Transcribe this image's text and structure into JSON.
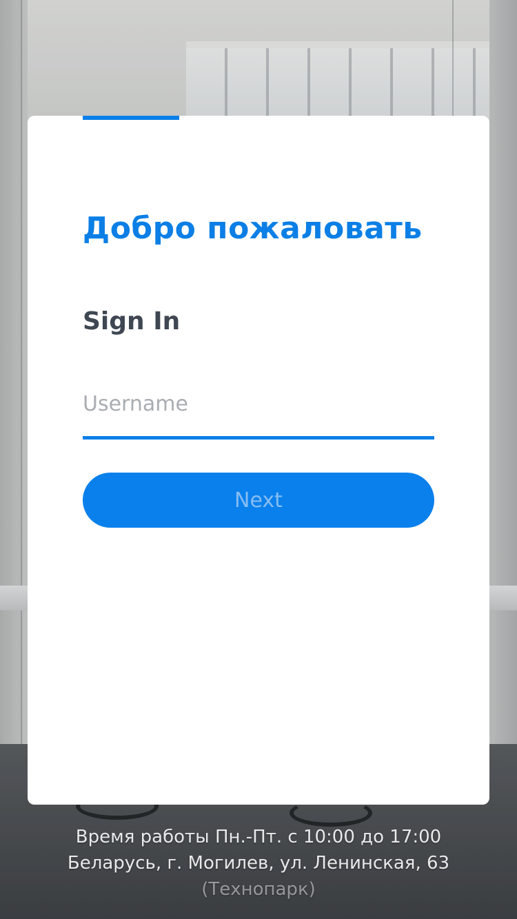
{
  "card": {
    "welcome_title": "Добро пожаловать",
    "signin_title": "Sign In",
    "username_placeholder": "Username",
    "username_value": "",
    "next_label": "Next"
  },
  "footer": {
    "hours": "Время работы Пн.-Пт. с 10:00 до 17:00",
    "address": "Беларусь, г. Могилев, ул. Ленинская, 63",
    "place": "(Технопарк)"
  },
  "colors": {
    "accent": "#0a7fe8",
    "title": "#0b7fe6",
    "heading": "#3e4752",
    "button_text": "#86bdf3"
  }
}
